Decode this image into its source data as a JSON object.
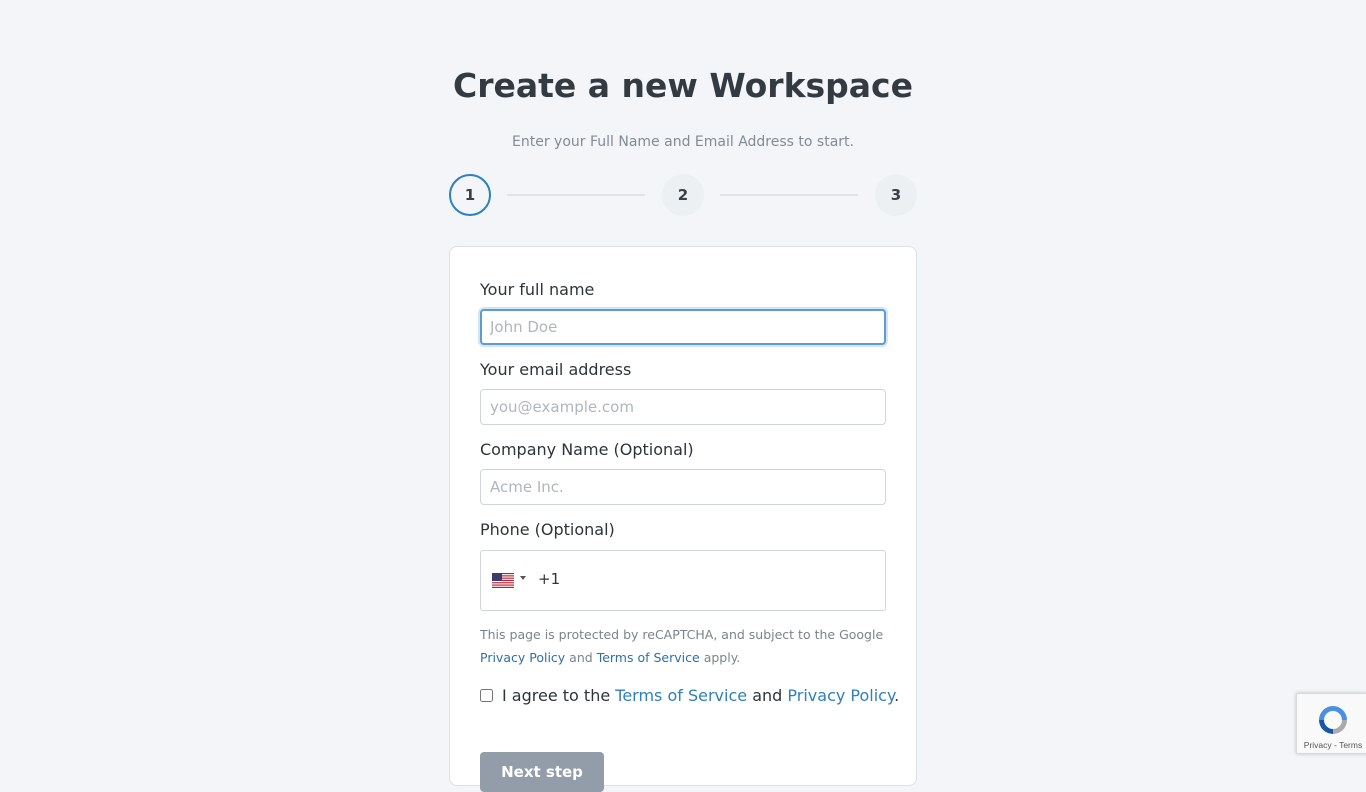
{
  "page": {
    "title": "Create a new Workspace",
    "subtitle": "Enter your Full Name and Email Address to start."
  },
  "stepper": {
    "steps": [
      "1",
      "2",
      "3"
    ],
    "active_step": "1"
  },
  "form": {
    "full_name": {
      "label": "Your full name",
      "placeholder": "John Doe",
      "value": ""
    },
    "email": {
      "label": "Your email address",
      "placeholder": "you@example.com",
      "value": ""
    },
    "company": {
      "label": "Company Name (Optional)",
      "placeholder": "Acme Inc.",
      "value": ""
    },
    "phone": {
      "label": "Phone (Optional)",
      "country": "US",
      "country_flag_icon": "us-flag-icon",
      "dial_code": "+1"
    }
  },
  "recaptcha_note": {
    "prefix": "This page is protected by reCAPTCHA, and subject to the Google",
    "privacy_link": "Privacy Policy",
    "and": "and",
    "terms_link": "Terms of Service",
    "suffix": "apply."
  },
  "agree": {
    "checked": false,
    "prefix": "I agree to the",
    "terms_link": "Terms of Service",
    "and": "and",
    "privacy_link": "Privacy Policy",
    "suffix": "."
  },
  "next_button": {
    "label": "Next step"
  },
  "recaptcha_badge": {
    "links": "Privacy - Terms"
  },
  "colors": {
    "accent": "#2e7fbe",
    "button_disabled": "#939daa",
    "background": "#f3f5f8"
  }
}
